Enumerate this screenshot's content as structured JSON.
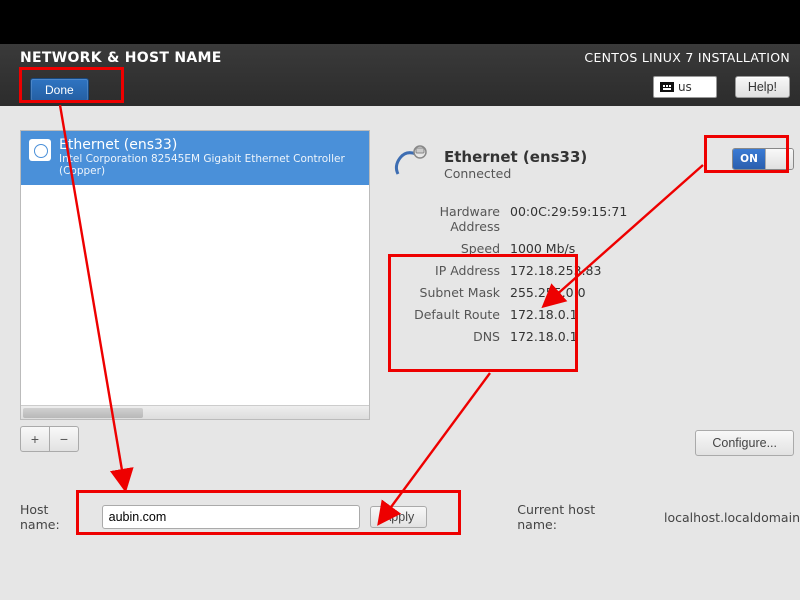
{
  "header": {
    "page_title": "NETWORK & HOST NAME",
    "install_title": "CENTOS LINUX 7 INSTALLATION",
    "keyboard_layout": "us",
    "help_label": "Help!",
    "done_label": "Done"
  },
  "left": {
    "items": [
      {
        "title": "Ethernet (ens33)",
        "subtitle": "Intel Corporation 82545EM Gigabit Ethernet Controller (Copper)"
      }
    ],
    "add_label": "+",
    "remove_label": "−"
  },
  "right": {
    "conn_title": "Ethernet (ens33)",
    "conn_status": "Connected",
    "toggle_on_label": "ON",
    "rows": {
      "hw_key": "Hardware Address",
      "hw_val": "00:0C:29:59:15:71",
      "speed_key": "Speed",
      "speed_val": "1000 Mb/s",
      "ip_key": "IP Address",
      "ip_val": "172.18.253.83",
      "mask_key": "Subnet Mask",
      "mask_val": "255.255.0.0",
      "gw_key": "Default Route",
      "gw_val": "172.18.0.1",
      "dns_key": "DNS",
      "dns_val": "172.18.0.1"
    },
    "configure_label": "Configure..."
  },
  "bottom": {
    "hostname_label": "Host name:",
    "hostname_value": "aubin.com",
    "apply_label": "Apply",
    "current_hostname_label": "Current host name:",
    "current_hostname_value": "localhost.localdomain"
  }
}
